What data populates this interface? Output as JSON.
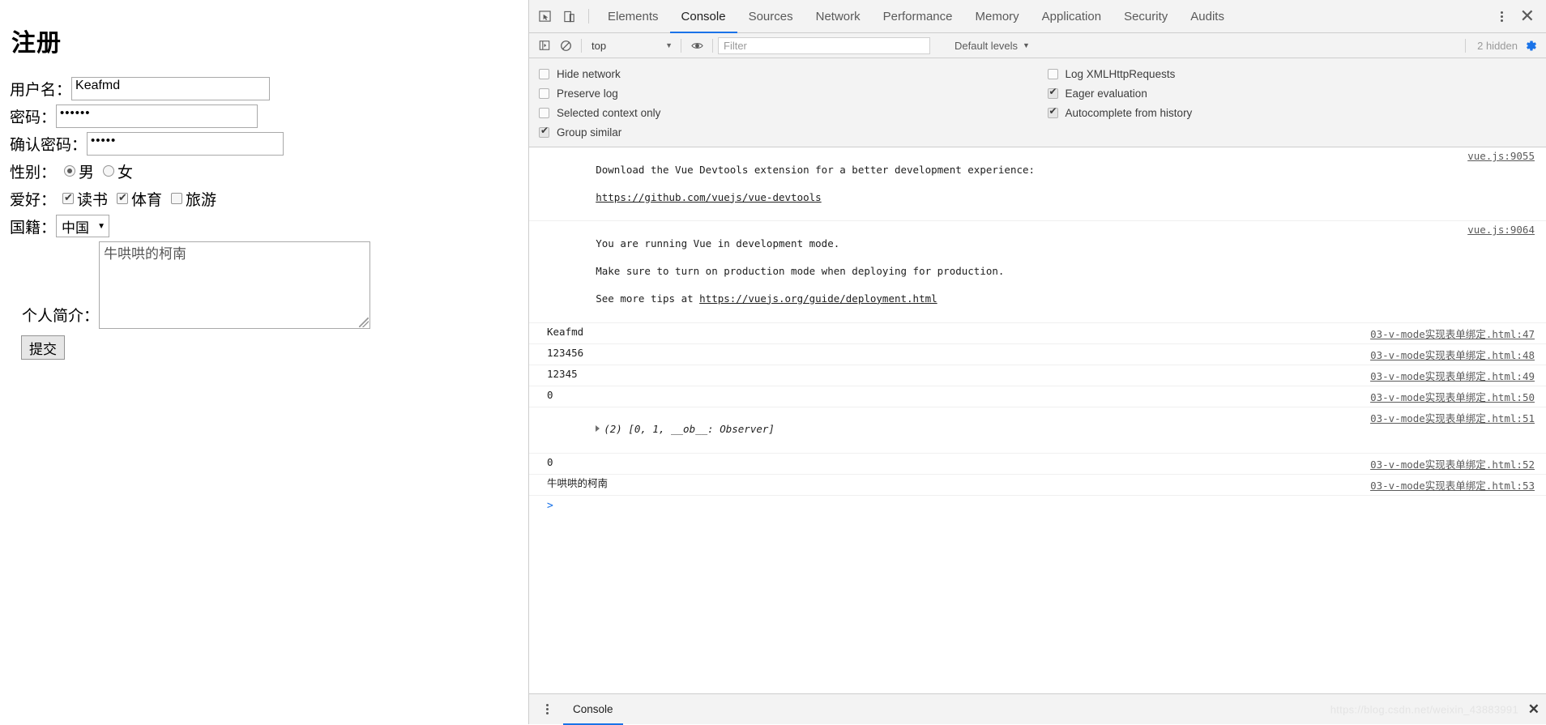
{
  "page": {
    "title": "注册",
    "fields": {
      "username": {
        "label": "用户名：",
        "value": "Keafmd"
      },
      "password": {
        "label": "密码：",
        "value": "••••••"
      },
      "confirm": {
        "label": "确认密码：",
        "value": "•••••"
      },
      "gender": {
        "label": "性别：",
        "options": [
          {
            "label": "男",
            "checked": true
          },
          {
            "label": "女",
            "checked": false
          }
        ]
      },
      "hobby": {
        "label": "爱好：",
        "options": [
          {
            "label": "读书",
            "checked": true
          },
          {
            "label": "体育",
            "checked": true
          },
          {
            "label": "旅游",
            "checked": false
          }
        ]
      },
      "nation": {
        "label": "国籍：",
        "value": "中国"
      },
      "bio": {
        "label": "个人简介：",
        "value": "牛哄哄的柯南"
      }
    },
    "submit_label": "提交"
  },
  "devtools": {
    "tabs": [
      {
        "label": "Elements",
        "active": false
      },
      {
        "label": "Console",
        "active": true
      },
      {
        "label": "Sources",
        "active": false
      },
      {
        "label": "Network",
        "active": false
      },
      {
        "label": "Performance",
        "active": false
      },
      {
        "label": "Memory",
        "active": false
      },
      {
        "label": "Application",
        "active": false
      },
      {
        "label": "Security",
        "active": false
      },
      {
        "label": "Audits",
        "active": false
      }
    ],
    "icons": {
      "inspect": "inspect-element-icon",
      "device": "device-toolbar-icon",
      "more": "more-options-icon",
      "close": "✕",
      "sidebar_toggle": "console-sidebar-icon",
      "clear": "clear-console-icon",
      "eye": "live-expression-icon",
      "gear": "settings-gear-icon"
    },
    "filterbar": {
      "context": "top",
      "filter_placeholder": "Filter",
      "levels": "Default levels",
      "hidden_count": "2 hidden",
      "accent": "#1a73e8"
    },
    "settings": {
      "left": [
        {
          "label": "Hide network",
          "checked": false
        },
        {
          "label": "Preserve log",
          "checked": false
        },
        {
          "label": "Selected context only",
          "checked": false
        },
        {
          "label": "Group similar",
          "checked": true
        }
      ],
      "right": [
        {
          "label": "Log XMLHttpRequests",
          "checked": false
        },
        {
          "label": "Eager evaluation",
          "checked": true
        },
        {
          "label": "Autocomplete from history",
          "checked": true
        }
      ]
    },
    "messages": [
      {
        "kind": "vue-devtools",
        "line1": "Download the Vue Devtools extension for a better development experience:",
        "link": "https://github.com/vuejs/vue-devtools",
        "source": "vue.js:9055"
      },
      {
        "kind": "vue-dev-mode",
        "line1": "You are running Vue in development mode.",
        "line2": "Make sure to turn on production mode when deploying for production.",
        "line3_prefix": "See more tips at ",
        "link": "https://vuejs.org/guide/deployment.html",
        "source": "vue.js:9064"
      },
      {
        "kind": "text",
        "text": "Keafmd",
        "source": "03-v-mode实现表单绑定.html:47"
      },
      {
        "kind": "text",
        "text": "123456",
        "source": "03-v-mode实现表单绑定.html:48"
      },
      {
        "kind": "text",
        "text": "12345",
        "source": "03-v-mode实现表单绑定.html:49"
      },
      {
        "kind": "number",
        "text": "0",
        "source": "03-v-mode实现表单绑定.html:50"
      },
      {
        "kind": "object",
        "text": "(2) [0, 1, __ob__: Observer]",
        "source": "03-v-mode实现表单绑定.html:51"
      },
      {
        "kind": "number",
        "text": "0",
        "source": "03-v-mode实现表单绑定.html:52"
      },
      {
        "kind": "cjk",
        "text": "牛哄哄的柯南",
        "source": "03-v-mode实现表单绑定.html:53"
      }
    ],
    "prompt": ">",
    "drawer": {
      "tab": "Console",
      "watermark": "https://blog.csdn.net/weixin_43883991",
      "close": "✕"
    }
  }
}
